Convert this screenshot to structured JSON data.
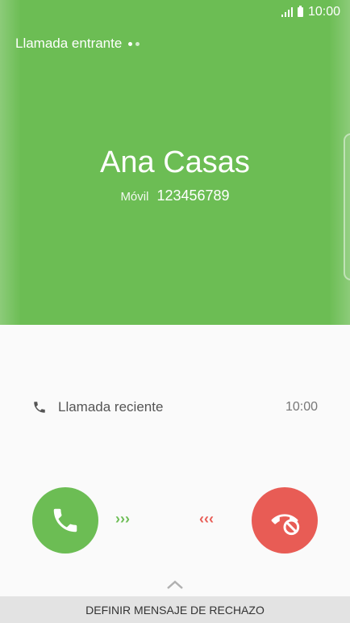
{
  "status_bar": {
    "time": "10:00"
  },
  "header": {
    "incoming_label": "Llamada entrante"
  },
  "caller": {
    "name": "Ana Casas",
    "number_type": "Móvil",
    "number": "123456789"
  },
  "recent_call": {
    "label": "Llamada reciente",
    "time": "10:00"
  },
  "actions": {
    "accept_icon": "phone-icon",
    "decline_icon": "phone-decline-icon",
    "accept_chevrons": "›››",
    "decline_chevrons": "‹‹‹"
  },
  "reject_message": {
    "label": "DEFINIR MENSAJE DE RECHAZO"
  },
  "colors": {
    "accent_green": "#6cbd54",
    "decline_red": "#e85c55",
    "background": "#fafafa"
  }
}
